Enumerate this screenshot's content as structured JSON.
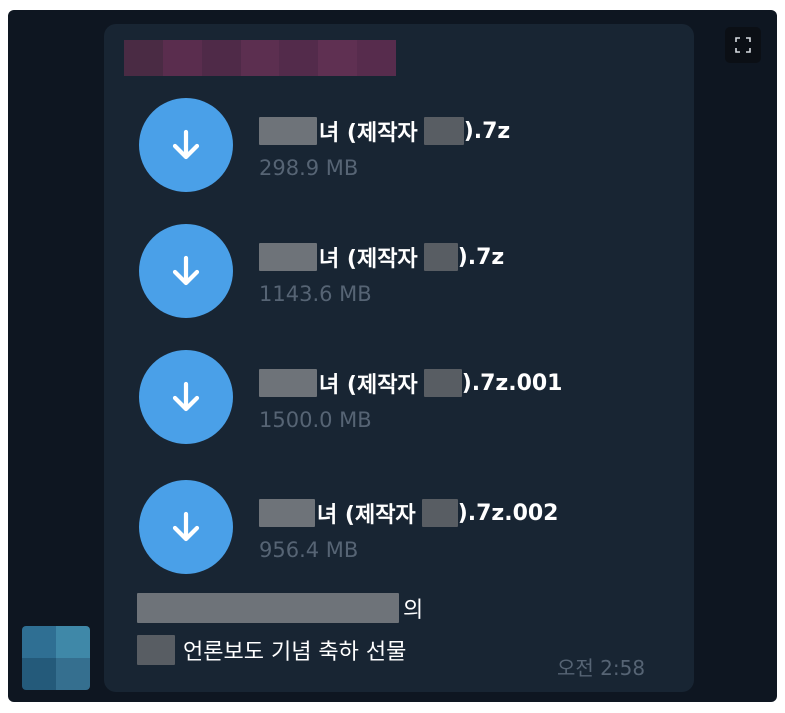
{
  "colors": {
    "background": "#0e1621",
    "bubble": "#182533",
    "download_button": "#4aa0e8",
    "file_name": "#ffffff",
    "meta_text": "#566474"
  },
  "message": {
    "files": [
      {
        "name_visible": "녀 (제작자",
        "name_suffix": ").7z",
        "size": "298.9 MB",
        "icon": "download-arrow-icon"
      },
      {
        "name_visible": "녀 (제작자",
        "name_suffix": ").7z",
        "size": "1143.6 MB",
        "icon": "download-arrow-icon"
      },
      {
        "name_visible": "녀 (제작자",
        "name_suffix": ").7z.001",
        "size": "1500.0 MB",
        "icon": "download-arrow-icon"
      },
      {
        "name_visible": "녀 (제작자",
        "name_suffix": ").7z.002",
        "size": "956.4 MB",
        "icon": "download-arrow-icon"
      }
    ],
    "caption_line1_suffix": "의",
    "caption_line2": "언론보도 기념 축하 선물",
    "time": "오전 2:58"
  },
  "controls": {
    "expand_icon": "expand-icon"
  }
}
